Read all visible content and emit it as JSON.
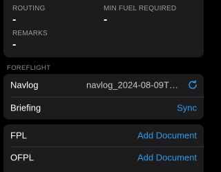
{
  "summary": {
    "routing_label": "ROUTING",
    "routing_value": "-",
    "min_fuel_label": "MIN FUEL REQUIRED",
    "min_fuel_value": "-",
    "remarks_label": "REMARKS",
    "remarks_value": "-"
  },
  "foreflight": {
    "section_title": "FOREFLIGHT",
    "navlog_label": "Navlog",
    "navlog_file": "navlog_2024-08-09T07...",
    "briefing_label": "Briefing",
    "briefing_action": "Sync"
  },
  "documents": {
    "fpl_label": "FPL",
    "fpl_action": "Add Document",
    "ofpl_label": "OFPL",
    "ofpl_action": "Add Document"
  },
  "colors": {
    "accent": "#2f9be8",
    "card_background": "#1c1c1e",
    "page_background": "#000000",
    "secondary_text": "#9a9aa0"
  },
  "icons": {
    "navlog_refresh": "refresh-icon"
  }
}
